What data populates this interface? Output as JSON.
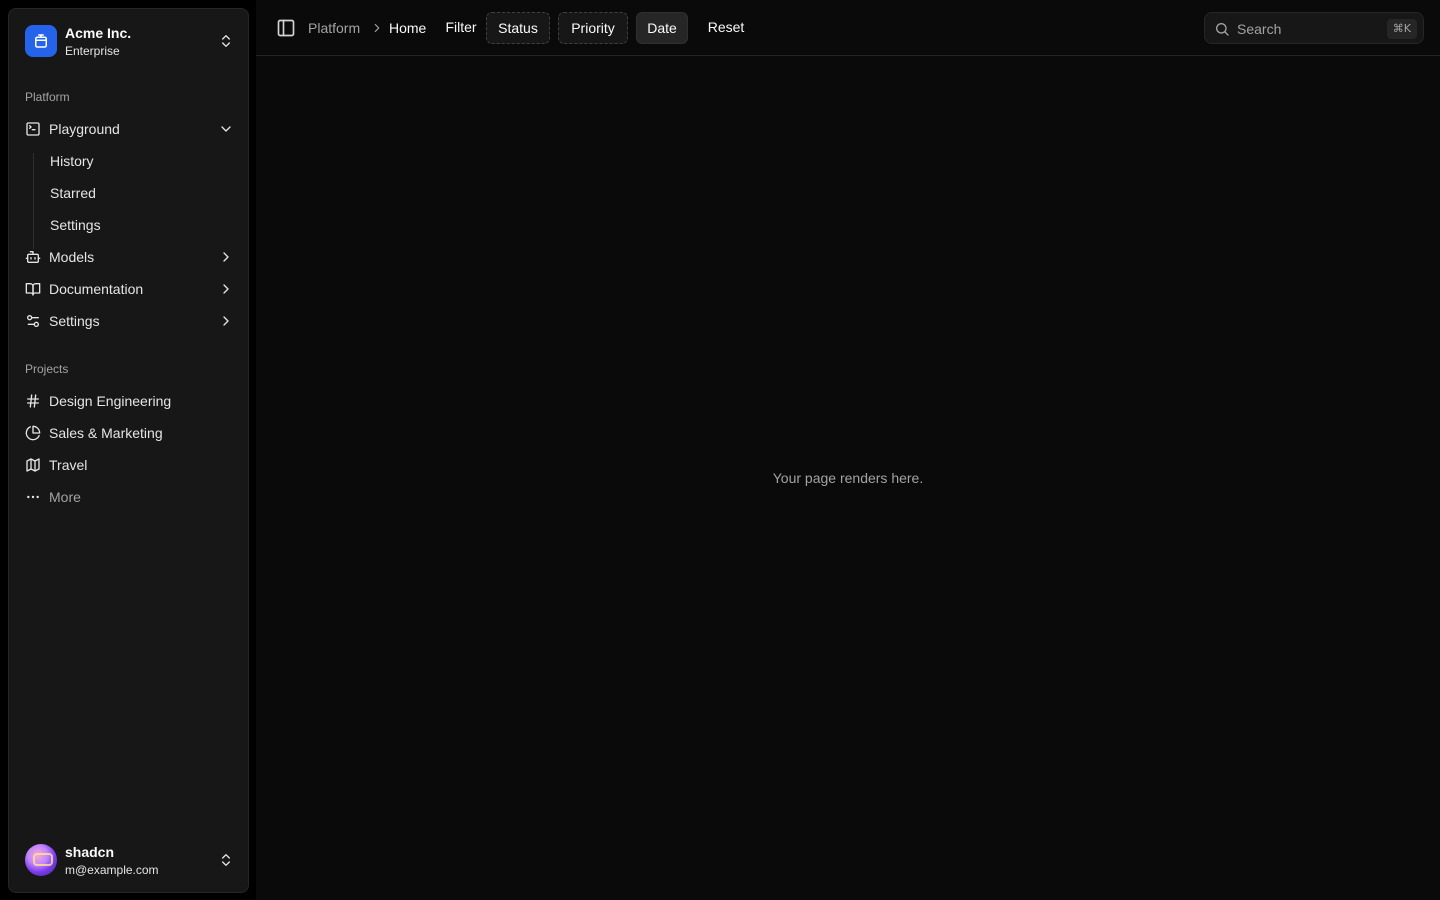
{
  "sidebar": {
    "team": {
      "name": "Acme Inc.",
      "plan": "Enterprise"
    },
    "platform_label": "Platform",
    "platform_items": [
      {
        "label": "Playground",
        "icon": "terminal-square-icon",
        "expanded": true
      },
      {
        "label": "Models",
        "icon": "bot-icon"
      },
      {
        "label": "Documentation",
        "icon": "book-open-icon"
      },
      {
        "label": "Settings",
        "icon": "settings-2-icon"
      }
    ],
    "playground_sub": [
      "History",
      "Starred",
      "Settings"
    ],
    "projects_label": "Projects",
    "projects": [
      {
        "label": "Design Engineering",
        "icon": "hash-icon"
      },
      {
        "label": "Sales & Marketing",
        "icon": "pie-chart-icon"
      },
      {
        "label": "Travel",
        "icon": "map-icon"
      }
    ],
    "more_label": "More",
    "user": {
      "name": "shadcn",
      "email": "m@example.com"
    }
  },
  "header": {
    "breadcrumb": [
      "Platform",
      "Home"
    ],
    "toolbar": {
      "filter": "Filter",
      "status": "Status",
      "priority": "Priority",
      "date": "Date",
      "reset": "Reset"
    },
    "search": {
      "placeholder": "Search",
      "shortcut": "⌘K"
    }
  },
  "main": {
    "placeholder": "Your page renders here."
  },
  "colors": {
    "accent": "#2563eb",
    "background": "#0a0a0a",
    "sidebar": "#171717"
  }
}
